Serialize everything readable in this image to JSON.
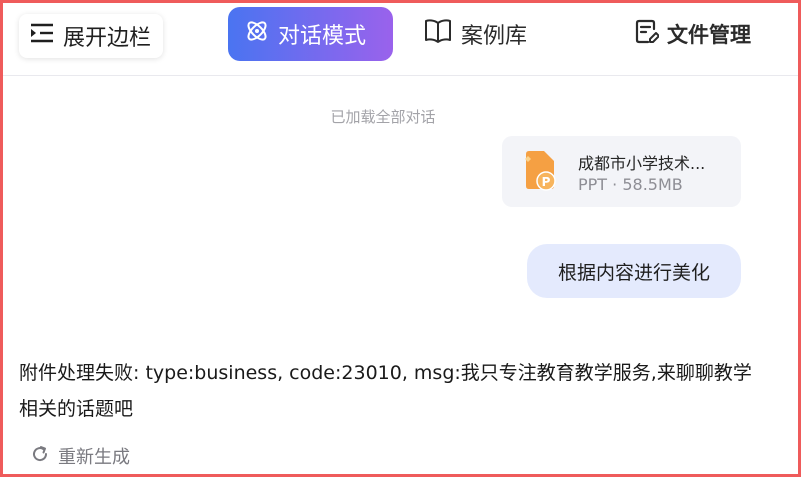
{
  "header": {
    "sidebar_toggle_label": "展开边栏",
    "tabs": [
      {
        "label": "对话模式",
        "icon": "atom-icon",
        "active": true
      },
      {
        "label": "案例库",
        "icon": "book-icon",
        "active": false
      },
      {
        "label": "文件管理",
        "icon": "file-edit-icon",
        "active": false
      }
    ]
  },
  "chat": {
    "status": "已加载全部对话",
    "attachment": {
      "name": "成都市小学技术...",
      "type": "PPT",
      "size": "58.5MB",
      "meta": "PPT · 58.5MB"
    },
    "user_message": "根据内容进行美化",
    "assistant_reply": "附件处理失败: type:business, code:23010, msg:我只专注教育教学服务,来聊聊教学相关的话题吧",
    "regenerate_label": "重新生成"
  },
  "colors": {
    "frame_border": "#ef5b5b",
    "tab_gradient_start": "#4a74f1",
    "tab_gradient_end": "#9a62ec",
    "user_bubble": "#e4eafd",
    "file_card": "#f3f4f8",
    "ppt_orange": "#f5a043"
  }
}
